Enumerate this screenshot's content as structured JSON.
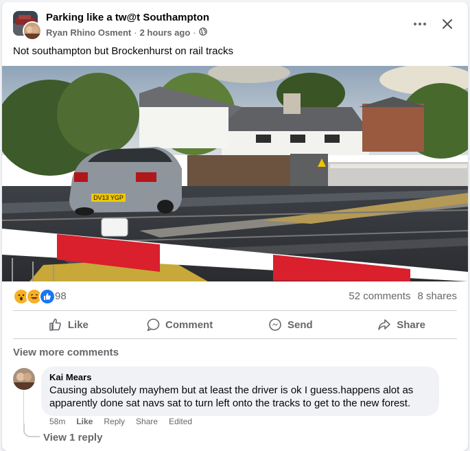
{
  "post": {
    "group_name": "Parking like a tw@t Southampton",
    "author": "Ryan Rhino Osment",
    "separator": "·",
    "time": "2 hours ago",
    "privacy_icon": "globe-icon",
    "caption": "Not southampton but Brockenhurst on rail tracks",
    "photo_plate": "DV13 YGP"
  },
  "reactions": {
    "icons": [
      "wow",
      "haha",
      "like"
    ],
    "count": "98",
    "comments": "52 comments",
    "shares": "8 shares"
  },
  "actions": {
    "like": "Like",
    "comment": "Comment",
    "send": "Send",
    "share": "Share"
  },
  "comments": {
    "view_more": "View more comments",
    "items": [
      {
        "name": "Kai Mears",
        "text": "Causing absolutely mayhem but at least the driver is ok I guess.happens alot as apparently done sat navs sat to turn left onto the tracks to get to the new forest.",
        "time": "58m",
        "like": "Like",
        "reply": "Reply",
        "share": "Share",
        "edited": "Edited"
      }
    ],
    "view_reply": "View 1 reply"
  },
  "colors": {
    "background": "#f0f2f5",
    "card": "#ffffff",
    "secondary_text": "#65676b",
    "like_blue": "#1877f2",
    "barrier_red": "#d9202c"
  }
}
